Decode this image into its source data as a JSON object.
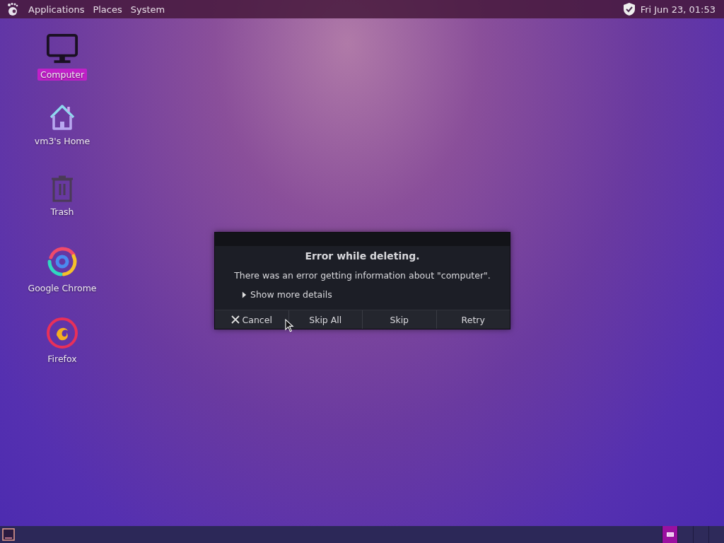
{
  "top_panel": {
    "menus": [
      "Applications",
      "Places",
      "System"
    ],
    "clock": "Fri Jun 23, 01:53"
  },
  "desktop_icons": [
    {
      "label": "Computer",
      "kind": "computer",
      "selected": true
    },
    {
      "label": "vm3's Home",
      "kind": "home",
      "selected": false
    },
    {
      "label": "Trash",
      "kind": "trash",
      "selected": false
    },
    {
      "label": "Google Chrome",
      "kind": "chrome",
      "selected": false
    },
    {
      "label": "Firefox",
      "kind": "firefox",
      "selected": false
    }
  ],
  "dialog": {
    "title": "Error while deleting.",
    "message": "There was an error getting information about \"computer\".",
    "details": {
      "label": "Show more details",
      "expanded": false
    },
    "buttons": [
      {
        "label": "Cancel",
        "kind": "cancel"
      },
      {
        "label": "Skip All",
        "kind": "plain"
      },
      {
        "label": "Skip",
        "kind": "plain"
      },
      {
        "label": "Retry",
        "kind": "plain"
      }
    ]
  },
  "bottom_panel": {
    "workspaces": [
      {
        "selected": true
      },
      {
        "selected": false
      },
      {
        "selected": false
      },
      {
        "selected": false
      }
    ]
  }
}
